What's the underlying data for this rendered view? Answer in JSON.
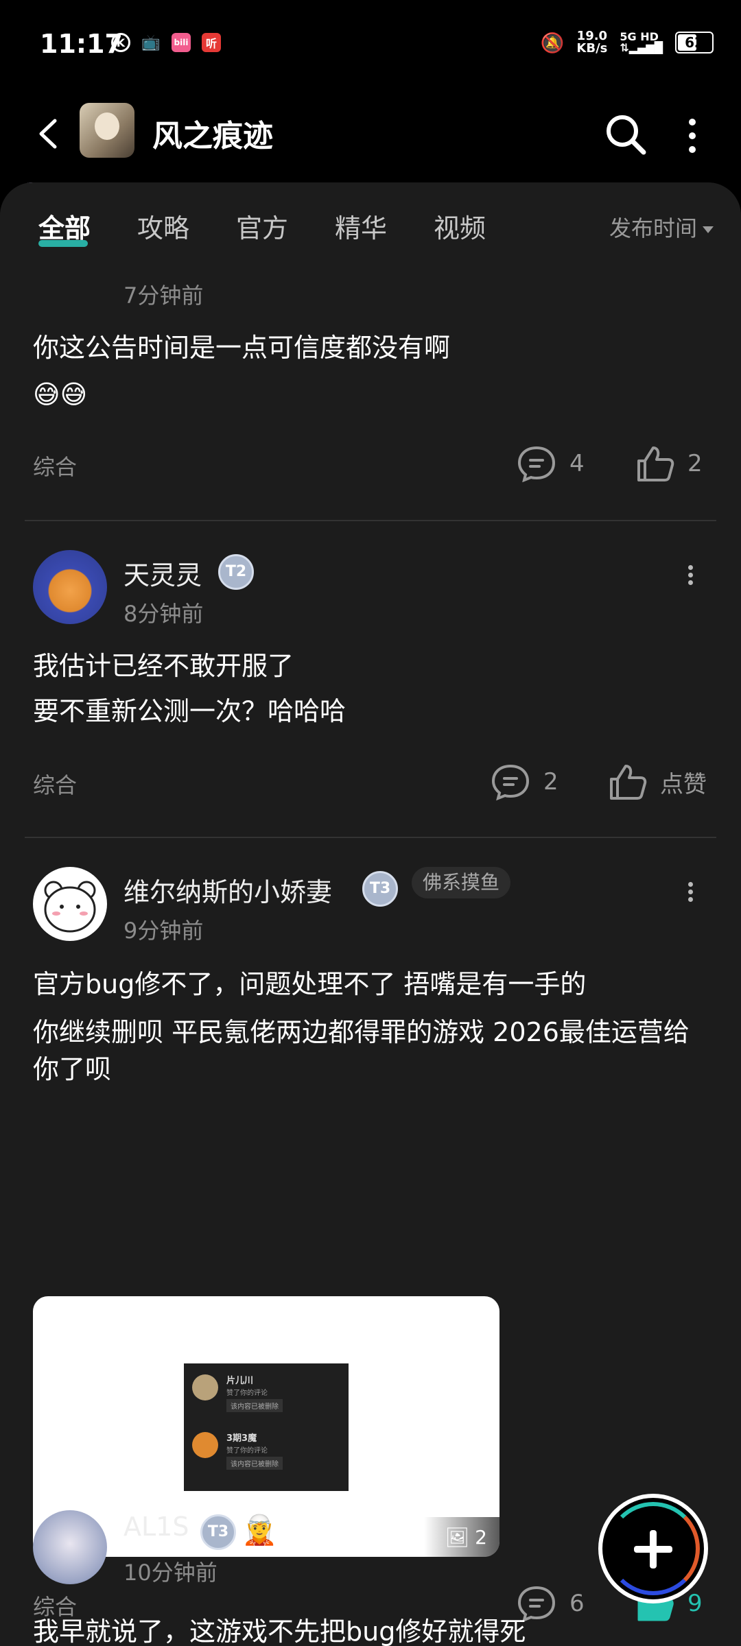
{
  "status_bar": {
    "time": "11:17",
    "net_speed_value": "19.0",
    "net_speed_unit": "KB/s",
    "signal": "5G HD",
    "battery": "62",
    "battery_level": 0.62
  },
  "header": {
    "title": "风之痕迹",
    "icons": [
      "back-arrow-icon",
      "game-icon",
      "search-icon",
      "more-vertical-icon"
    ]
  },
  "tabs": {
    "items": [
      "全部",
      "攻略",
      "官方",
      "精华",
      "视频"
    ],
    "active_index": 0,
    "sort_label": "发布时间"
  },
  "posts": [
    {
      "time": "7分钟前",
      "lines": [
        "你这公告时间是一点可信度都没有啊",
        "😅😅"
      ],
      "category": "综合",
      "comments": "4",
      "likes": "2"
    },
    {
      "username": "天灵灵",
      "level": "2",
      "time": "8分钟前",
      "lines": [
        "我估计已经不敢开服了",
        "要不重新公测一次？哈哈哈"
      ],
      "category": "综合",
      "comments": "2",
      "likes": "点赞"
    },
    {
      "username": "维尔纳斯的小娇妻",
      "level": "3",
      "tag": "佛系摸鱼",
      "time": "9分钟前",
      "lines": [
        "官方bug修不了，问题处理不了 捂嘴是有一手的",
        "你继续删呗 平民氪佬两边都得罪的游戏 2026最佳运营给你了呗"
      ],
      "image": {
        "count": "2",
        "rows": [
          {
            "name": "片儿川",
            "sub": "赞了你的评论",
            "chip": "该内容已被删除"
          },
          {
            "name": "3期3魔",
            "sub": "赞了你的评论",
            "chip": "该内容已被删除"
          }
        ]
      },
      "category": "综合",
      "comments": "6",
      "likes": "9",
      "liked": true
    },
    {
      "username": "AL1S",
      "level": "3",
      "time": "10分钟前",
      "lines": [
        "我早就说了，这游戏不先把bug修好就得死"
      ]
    }
  ],
  "colors": {
    "accent": "#24c3b1",
    "background": "#1c1c1c"
  }
}
